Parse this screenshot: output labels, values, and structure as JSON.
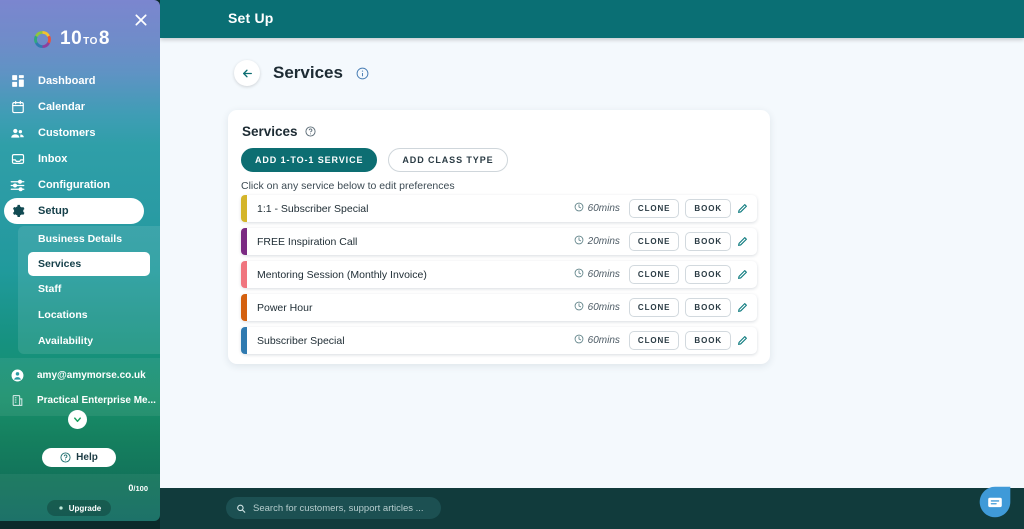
{
  "sidebar": {
    "logo": {
      "main": "10",
      "small": "TO",
      "tail": "8",
      "icon": "ring-logo-icon"
    },
    "close_icon": "close-icon",
    "nav": [
      {
        "label": "Dashboard",
        "icon": "dashboard-icon",
        "active": false
      },
      {
        "label": "Calendar",
        "icon": "calendar-icon",
        "active": false
      },
      {
        "label": "Customers",
        "icon": "customers-icon",
        "active": false
      },
      {
        "label": "Inbox",
        "icon": "inbox-icon",
        "active": false
      },
      {
        "label": "Configuration",
        "icon": "sliders-icon",
        "active": false
      },
      {
        "label": "Setup",
        "icon": "gear-icon",
        "active": true
      }
    ],
    "subnav": [
      {
        "label": "Business Details",
        "active": false
      },
      {
        "label": "Services",
        "active": true
      },
      {
        "label": "Staff",
        "active": false
      },
      {
        "label": "Locations",
        "active": false
      },
      {
        "label": "Availability",
        "active": false
      }
    ],
    "account": {
      "email": "amy@amymorse.co.uk",
      "business": "Practical Enterprise Me...",
      "email_icon": "user-circle-icon",
      "business_icon": "building-icon",
      "caret_icon": "chevron-down-icon"
    },
    "help_label": "Help",
    "help_icon": "question-circle-icon",
    "quota": {
      "used": "0",
      "separator": "/",
      "total": "100"
    },
    "upgrade_label": "Upgrade",
    "upgrade_icon": "spark-icon"
  },
  "header": {
    "title": "Set Up"
  },
  "page": {
    "back_icon": "back-arrow-icon",
    "title": "Services",
    "info_icon": "info-icon"
  },
  "card": {
    "title": "Services",
    "title_info_icon": "help-circle-icon",
    "add_one_to_one_label": "ADD 1-TO-1 SERVICE",
    "add_class_label": "ADD CLASS TYPE",
    "hint": "Click on any service below to edit preferences",
    "clock_icon": "clock-icon",
    "clone_label": "CLONE",
    "book_label": "BOOK",
    "edit_icon": "pencil-icon",
    "services": [
      {
        "name": "1:1 - Subscriber Special",
        "duration": "60mins",
        "accent": "#d4b52a"
      },
      {
        "name": "FREE Inspiration Call",
        "duration": "20mins",
        "accent": "#7b2a82"
      },
      {
        "name": "Mentoring Session (Monthly Invoice)",
        "duration": "60mins",
        "accent": "#f0757e"
      },
      {
        "name": "Power Hour",
        "duration": "60mins",
        "accent": "#d4600f"
      },
      {
        "name": "Subscriber Special",
        "duration": "60mins",
        "accent": "#2f7ab0"
      }
    ]
  },
  "bottom": {
    "search_placeholder": "Search for customers, support articles ...",
    "search_value": "",
    "search_icon": "search-icon",
    "chat_icon": "chat-bubble-icon"
  },
  "colors": {
    "teal": "#0a6f74",
    "primary_button": "#0d6e72",
    "content_bg": "#f4f9fd",
    "bottom_bar": "#113b3c",
    "chat_blue": "#3f9ad8"
  }
}
